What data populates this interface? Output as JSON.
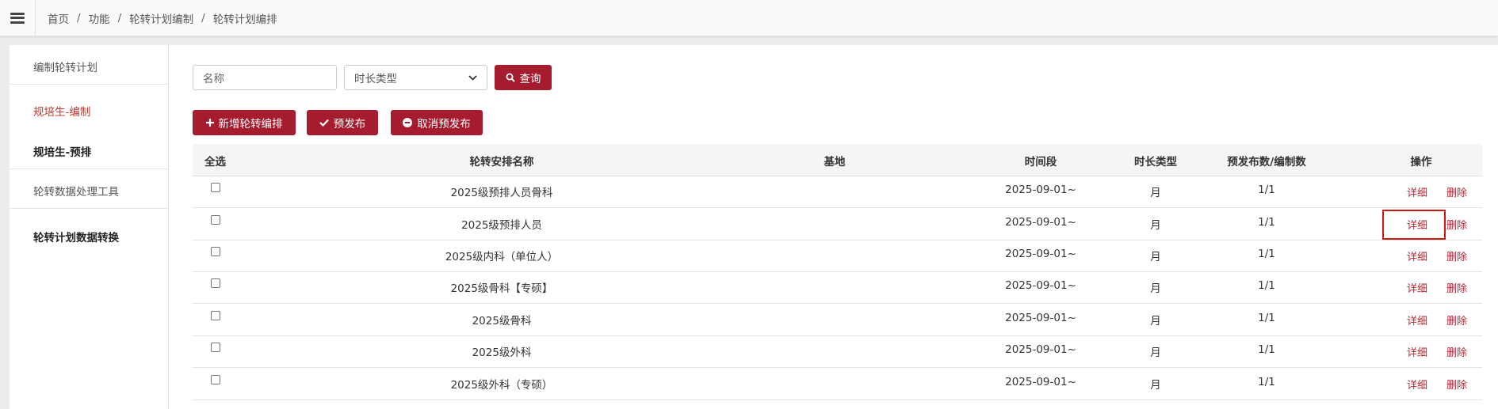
{
  "breadcrumb": [
    "首页",
    "功能",
    "轮转计划编制",
    "轮转计划编排"
  ],
  "left_menu": [
    {
      "label": "编制轮转计划",
      "state": "normal"
    },
    {
      "label": "规培生-编制",
      "state": "active"
    },
    {
      "label": "规培生-预排",
      "state": "bold"
    },
    {
      "label": "轮转数据处理工具",
      "state": "normal"
    },
    {
      "label": "轮转计划数据转换",
      "state": "bold"
    }
  ],
  "filters": {
    "name_placeholder": "名称",
    "duration_select": "时长类型",
    "query_label": "查询"
  },
  "actions": {
    "add_label": "新增轮转编排",
    "prepublish_label": "预发布",
    "cancel_prepublish_label": "取消预发布"
  },
  "table": {
    "headers": [
      "全选",
      "轮转安排名称",
      "基地",
      "时间段",
      "时长类型",
      "预发布数/编制数",
      "操作"
    ],
    "rows": [
      {
        "name": "2025级预排人员骨科",
        "base": "",
        "period": "2025-09-01~",
        "duration": "月",
        "count": "1/1"
      },
      {
        "name": "2025级预排人员",
        "base": "",
        "period": "2025-09-01~",
        "duration": "月",
        "count": "1/1"
      },
      {
        "name": "2025级内科（单位人）",
        "base": "",
        "period": "2025-09-01~",
        "duration": "月",
        "count": "1/1"
      },
      {
        "name": "2025级骨科【专硕】",
        "base": "",
        "period": "2025-09-01~",
        "duration": "月",
        "count": "1/1"
      },
      {
        "name": "2025级骨科",
        "base": "",
        "period": "2025-09-01~",
        "duration": "月",
        "count": "1/1"
      },
      {
        "name": "2025级外科",
        "base": "",
        "period": "2025-09-01~",
        "duration": "月",
        "count": "1/1"
      },
      {
        "name": "2025级外科（专硕）",
        "base": "",
        "period": "2025-09-01~",
        "duration": "月",
        "count": "1/1"
      }
    ],
    "detail_label": "详细",
    "delete_label": "删除"
  },
  "colors": {
    "accent": "#a51c2f",
    "link": "#b52a36",
    "highlight": "#d01818"
  }
}
